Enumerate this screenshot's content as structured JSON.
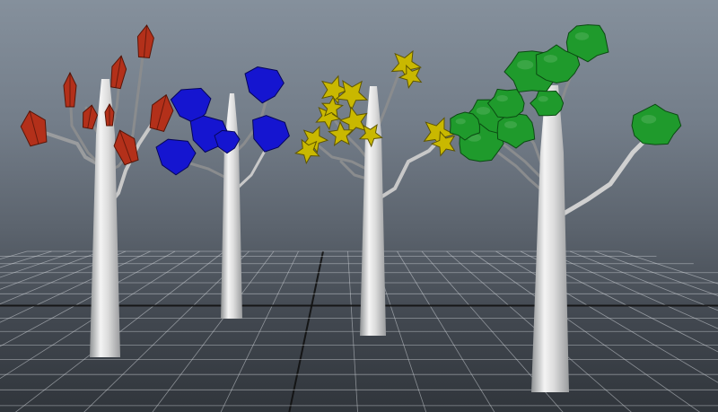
{
  "viewport": {
    "view": "perspective",
    "background_top": "#85909c",
    "background_bottom": "#30353b",
    "grid_color": "#cfd3d8",
    "grid_axis_color": "#111111"
  },
  "trees": [
    {
      "name": "tree-red",
      "leaf_color": "#b3301a",
      "leaf_shape": "diamond"
    },
    {
      "name": "tree-blue",
      "leaf_color": "#1515d0",
      "leaf_shape": "cup"
    },
    {
      "name": "tree-yellow",
      "leaf_color": "#c9b800",
      "leaf_shape": "star-cluster"
    },
    {
      "name": "tree-green",
      "leaf_color": "#1f9a2c",
      "leaf_shape": "blob-cluster"
    }
  ]
}
